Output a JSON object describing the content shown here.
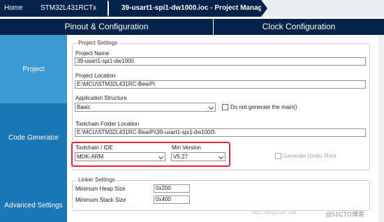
{
  "breadcrumb": {
    "home": "Home",
    "device": "STM32L431RCTx",
    "page": "39-usart1-spi1-dw1000.ioc - Project Manager"
  },
  "tabs": {
    "pinout": "Pinout & Configuration",
    "clock": "Clock Configuration"
  },
  "sidebar": {
    "items": [
      {
        "label": "Project"
      },
      {
        "label": "Code Generator"
      },
      {
        "label": "Advanced Settings"
      }
    ]
  },
  "project_settings": {
    "legend": "Project Settings",
    "name_label": "Project Name",
    "name_value": "39-usart1-spi1-dw1000",
    "location_label": "Project Location",
    "location_value": "E:\\MCU\\STM32L431RC-BearPi",
    "structure_label": "Application Structure",
    "structure_value": "Basic",
    "no_main_label": "Do not generate the main()",
    "toolchain_folder_label": "Toolchain Folder Location",
    "toolchain_folder_value": "E:\\MCU\\STM32L431RC-BearPi\\39-usart1-spi1-dw1000\\",
    "toolchain_label": "Toolchain / IDE",
    "toolchain_value": "MDK-ARM",
    "min_version_label": "Min Version",
    "min_version_value": "V5.27",
    "generate_root_label": "Generate Under Root"
  },
  "linker_settings": {
    "legend": "Linker Settings",
    "heap_label": "Minimum Heap Size",
    "heap_value": "0x200",
    "stack_label": "Minimum Stack Size",
    "stack_value": "0x400"
  },
  "watermark": {
    "url": "https://blog.csdn.net/",
    "brand": "@51CTO博客"
  },
  "colors": {
    "nav_dark": "#03234b",
    "sidebar_active": "#3c9ad3",
    "sidebar": "#1c77b8",
    "highlight": "#e8212f"
  }
}
